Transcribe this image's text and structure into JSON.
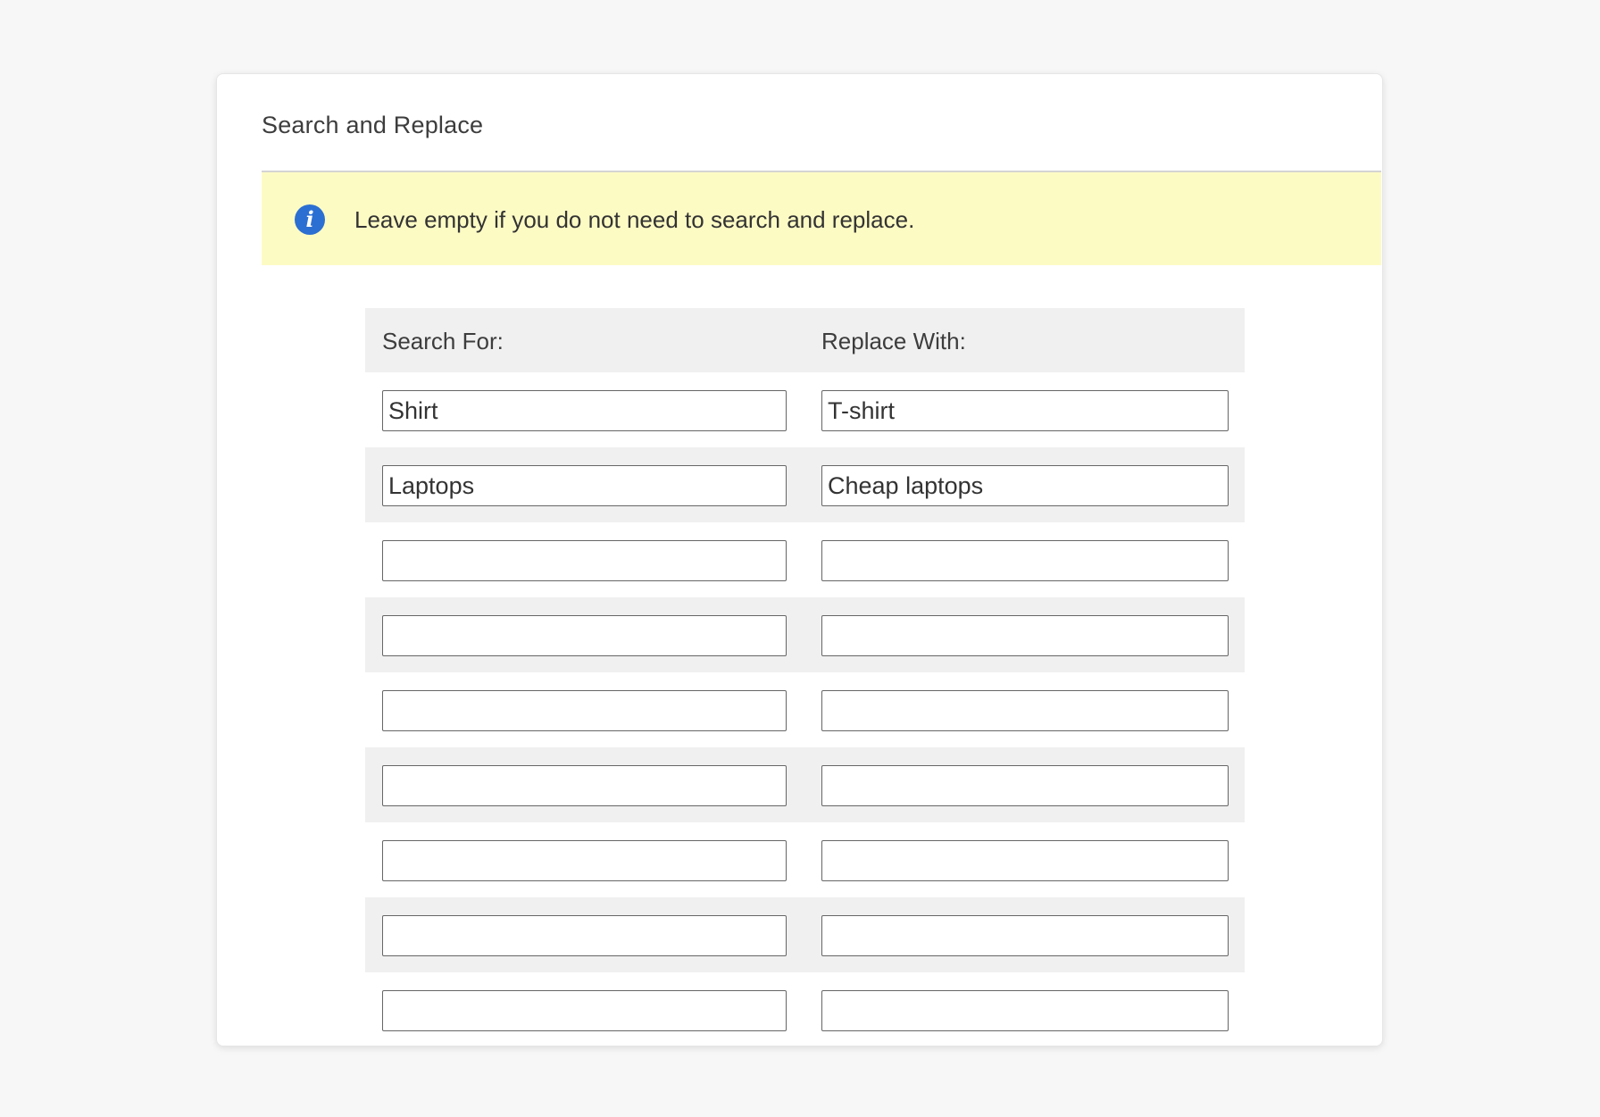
{
  "panel": {
    "title": "Search and Replace"
  },
  "notice": {
    "icon": "info-icon",
    "text": "Leave empty if you do not need to search and replace.",
    "background_color": "#fdfbc4",
    "icon_color": "#2c6fd3"
  },
  "grid": {
    "headers": {
      "search": "Search For:",
      "replace": "Replace With:"
    },
    "rows": [
      {
        "search": "Shirt",
        "replace": "T-shirt"
      },
      {
        "search": "Laptops",
        "replace": "Cheap laptops"
      },
      {
        "search": "",
        "replace": ""
      },
      {
        "search": "",
        "replace": ""
      },
      {
        "search": "",
        "replace": ""
      },
      {
        "search": "",
        "replace": ""
      },
      {
        "search": "",
        "replace": ""
      },
      {
        "search": "",
        "replace": ""
      },
      {
        "search": "",
        "replace": ""
      }
    ]
  }
}
